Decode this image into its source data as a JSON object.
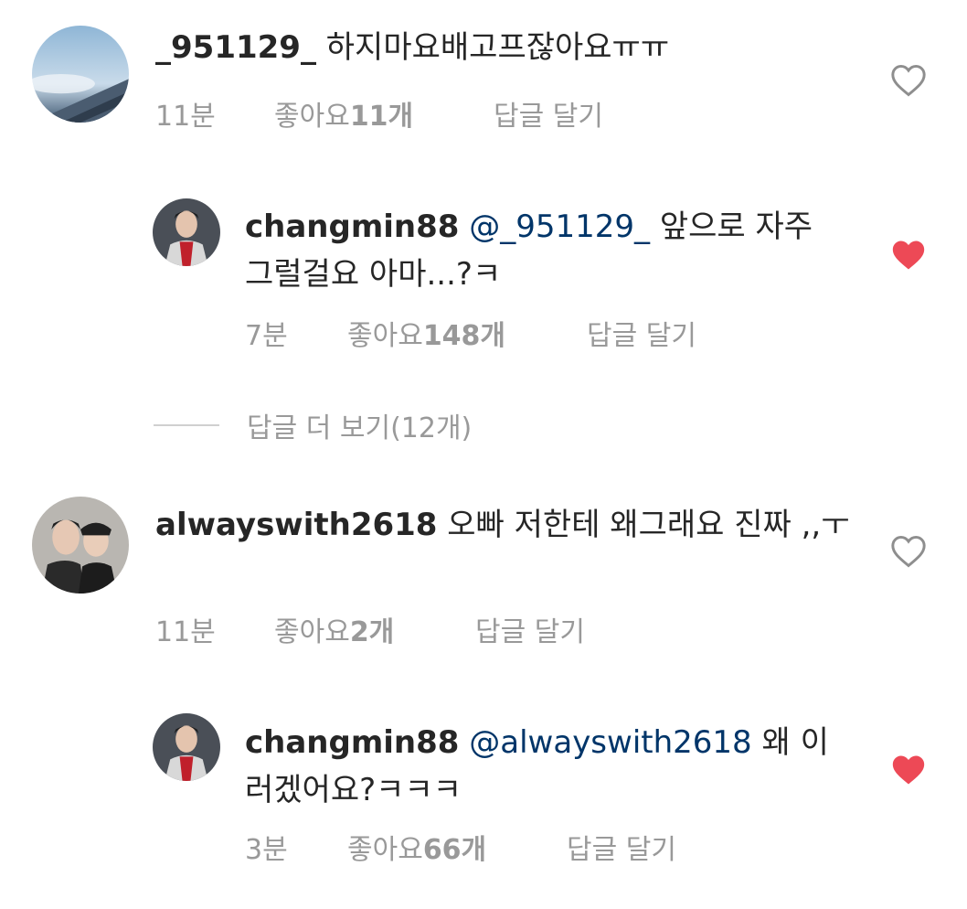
{
  "comments": [
    {
      "username": "_951129_",
      "mention": "",
      "text": " 하지마요배고프잖아요ㅠㅠ",
      "time": "11분",
      "likes_label": "좋아요 ",
      "likes_count": "11개",
      "reply_label": "답글 달기",
      "liked": false
    },
    {
      "username": "changmin88",
      "mention": "@_951129_",
      "text": " 앞으로 자주 그럴걸요 아마...?ㅋ",
      "time": "7분",
      "likes_label": "좋아요 ",
      "likes_count": "148개",
      "reply_label": "답글 달기",
      "liked": true
    },
    {
      "username": "alwayswith2618",
      "mention": "",
      "text": " 오빠 저한테 왜그래요 진짜 ,,ㅜ",
      "time": "11분",
      "likes_label": "좋아요 ",
      "likes_count": "2개",
      "reply_label": "답글 달기",
      "liked": false
    },
    {
      "username": "changmin88",
      "mention": "@alwayswith2618",
      "text": " 왜 이러겠어요?ㅋㅋㅋ",
      "time": "3분",
      "likes_label": "좋아요 ",
      "likes_count": "66개",
      "reply_label": "답글 달기",
      "liked": true
    }
  ],
  "more_replies": "답글 더 보기(12개)",
  "colors": {
    "heart_liked": "#ed4956",
    "heart_outline": "#8e8e8e",
    "mention": "#003569",
    "meta": "#999999"
  }
}
